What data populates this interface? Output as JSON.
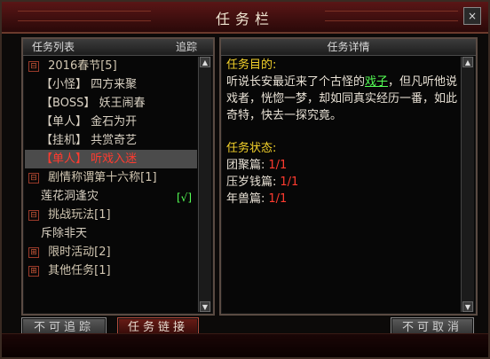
{
  "window": {
    "title": "任务栏"
  },
  "left_panel": {
    "header_left": "任务列表",
    "header_right": "追踪",
    "items": [
      {
        "type": "category",
        "expander": "⊟",
        "label": "2016春节[5]"
      },
      {
        "type": "quest",
        "tag": "【小怪】",
        "text": "四方来聚"
      },
      {
        "type": "quest",
        "tag": "【BOSS】",
        "text": "妖王闹春"
      },
      {
        "type": "quest",
        "tag": "【单人】",
        "text": "金石为开"
      },
      {
        "type": "quest",
        "tag": "【挂机】",
        "text": "共赏奇艺"
      },
      {
        "type": "quest",
        "tag": "【单人】",
        "text": "听戏入迷",
        "selected": true
      },
      {
        "type": "category",
        "expander": "⊟",
        "label": "剧情称谓第十六称[1]"
      },
      {
        "type": "quest",
        "tag": "",
        "text": "莲花洞逢灾",
        "track": "[√]"
      },
      {
        "type": "category",
        "expander": "⊟",
        "label": "挑战玩法[1]"
      },
      {
        "type": "quest",
        "tag": "",
        "text": "斥除非天"
      },
      {
        "type": "category",
        "expander": "⊞",
        "label": "限时活动[2]"
      },
      {
        "type": "category",
        "expander": "⊞",
        "label": "其他任务[1]"
      }
    ]
  },
  "right_panel": {
    "header": "任务详情",
    "goal_label": "任务目的:",
    "goal_text_1": "听说长安最近来了个古怪的",
    "goal_highlight": "戏子",
    "goal_text_2": "，但凡听他说戏者，恍惚一梦，却如同真实经历一番，如此奇特，快去一探究竟。",
    "status_label": "任务状态:",
    "statuses": [
      {
        "name": "团聚篇:",
        "value": "1/1"
      },
      {
        "name": "压岁钱篇:",
        "value": "1/1"
      },
      {
        "name": "年兽篇:",
        "value": "1/1"
      }
    ]
  },
  "buttons": {
    "untrack": "不可追踪",
    "link": "任务链接",
    "cancel": "不可取消"
  },
  "icons": {
    "close": "close-icon",
    "scroll_up": "scroll-up-icon",
    "scroll_down": "scroll-down-icon"
  }
}
